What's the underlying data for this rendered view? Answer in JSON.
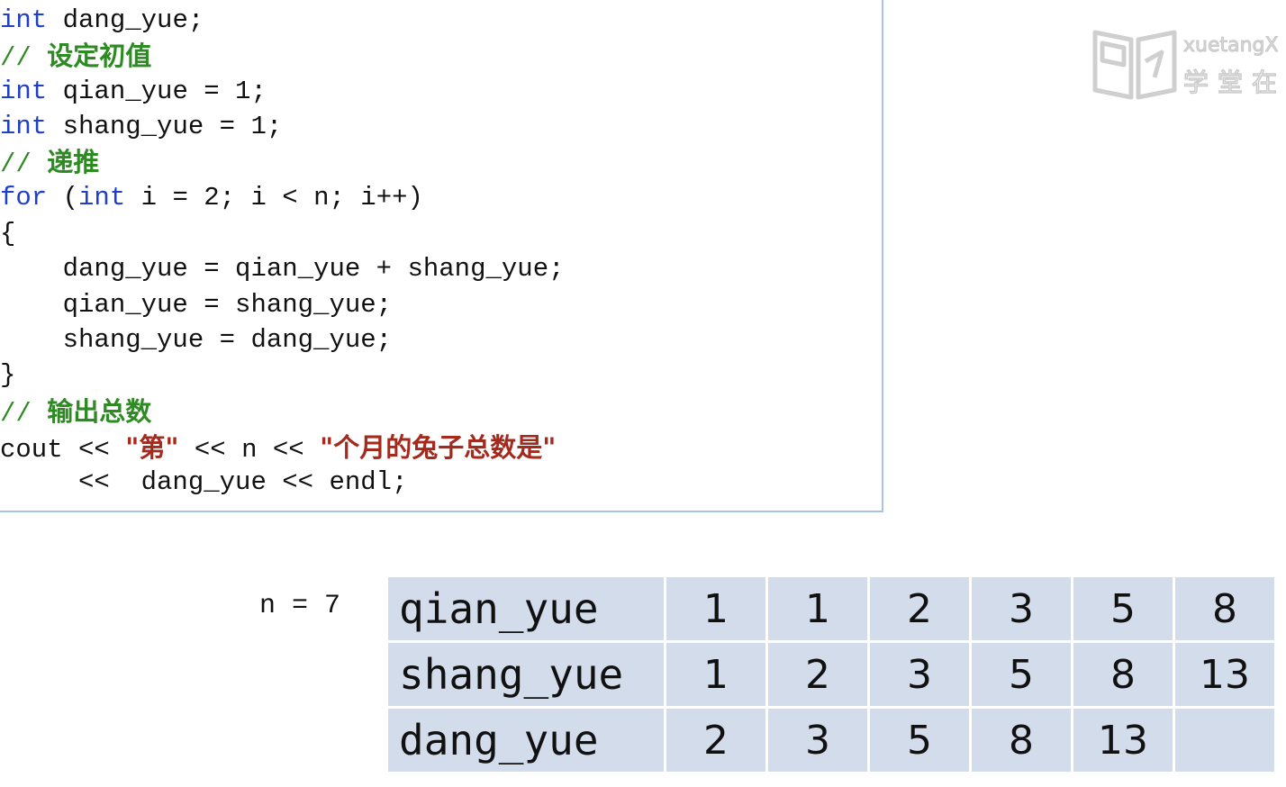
{
  "code": {
    "line1": {
      "kw": "int",
      "rest": " dang_yue;"
    },
    "line2": {
      "slash": "// ",
      "text": "设定初值"
    },
    "line3": {
      "kw": "int",
      "rest": " qian_yue = 1;"
    },
    "line4": {
      "kw": "int",
      "rest": " shang_yue = 1;"
    },
    "line5": {
      "slash": "// ",
      "text": "递推"
    },
    "line6": {
      "kw": "for",
      "mid": " (",
      "kw2": "int",
      "rest": " i = 2; i < n; i++)"
    },
    "line7": "{",
    "line8": "    dang_yue = qian_yue + shang_yue;",
    "line9": "    qian_yue = shang_yue;",
    "line10": "    shang_yue = dang_yue;",
    "line11": "}",
    "line12": {
      "slash": "// ",
      "text": "输出总数"
    },
    "line13": {
      "a": "cout << ",
      "s1": "\"第\"",
      "b": " << n << ",
      "s2": "\"个月的兔子总数是\""
    },
    "line14": "     <<  dang_yue << endl;"
  },
  "logo": {
    "en": "xuetangX",
    "zh": "学堂在"
  },
  "n_label": "n = 7",
  "trace_table": {
    "rows": [
      {
        "name": "qian_yue",
        "values": [
          "1",
          "1",
          "2",
          "3",
          "5",
          "8"
        ]
      },
      {
        "name": "shang_yue",
        "values": [
          "1",
          "2",
          "3",
          "5",
          "8",
          "13"
        ]
      },
      {
        "name": "dang_yue",
        "values": [
          "2",
          "3",
          "5",
          "8",
          "13",
          ""
        ]
      }
    ]
  },
  "colors": {
    "keyword": "#1f3fc8",
    "comment": "#2e8a22",
    "string": "#a42a1e",
    "table_cell": "#d3dcea",
    "panel_border": "#a8c4e0"
  }
}
